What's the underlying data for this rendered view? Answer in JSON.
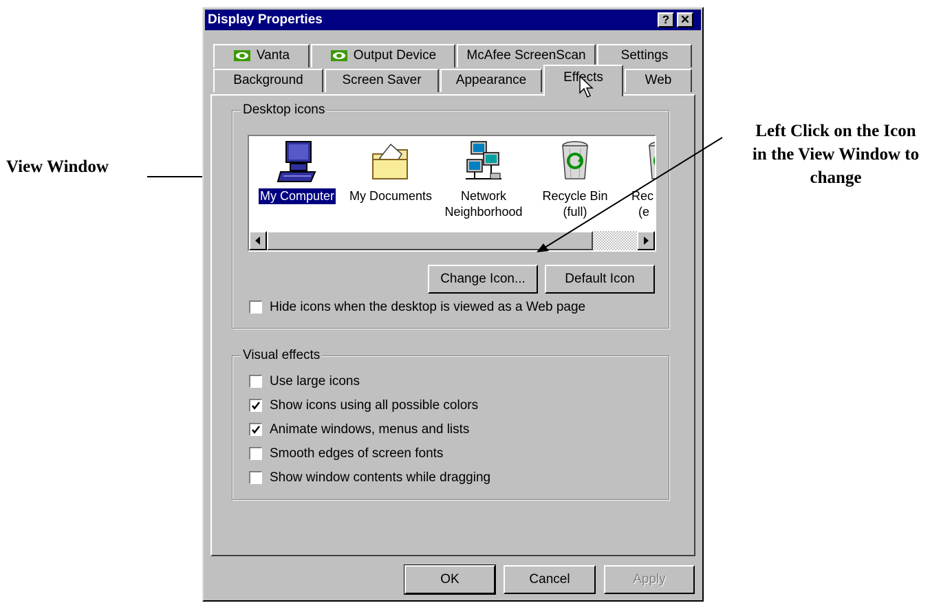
{
  "annotations": {
    "view_window_label": "View Window",
    "instruction_line1": "Left Click on the Icon",
    "instruction_line2": "in the View Window to",
    "instruction_line3": "change"
  },
  "window": {
    "title": "Display Properties",
    "help_button": "?",
    "close_button": "✕"
  },
  "tabs_back": [
    {
      "label": "Vanta",
      "icon": "nvidia-icon"
    },
    {
      "label": "Output Device",
      "icon": "nvidia-icon"
    },
    {
      "label": "McAfee ScreenScan"
    },
    {
      "label": "Settings"
    }
  ],
  "tabs_front": [
    {
      "label": "Background"
    },
    {
      "label": "Screen Saver"
    },
    {
      "label": "Appearance"
    },
    {
      "label": "Effects",
      "active": true
    },
    {
      "label": "Web"
    }
  ],
  "desktop_icons": {
    "legend": "Desktop icons",
    "items": [
      {
        "label": "My Computer",
        "icon": "my-computer-icon",
        "selected": true
      },
      {
        "label": "My Documents",
        "icon": "folder-icon"
      },
      {
        "label_line1": "Network",
        "label_line2": "Neighborhood",
        "icon": "network-neighborhood-icon"
      },
      {
        "label_line1": "Recycle Bin",
        "label_line2": "(full)",
        "icon": "recycle-bin-full-icon"
      },
      {
        "label_line1": "Rec",
        "label_line2": "(e",
        "icon": "recycle-bin-empty-icon"
      }
    ],
    "change_icon_button": "Change Icon...",
    "default_icon_button": "Default Icon",
    "hide_icons_label": "Hide icons when the desktop is viewed as a Web page",
    "hide_icons_checked": false
  },
  "visual_effects": {
    "legend": "Visual effects",
    "options": [
      {
        "label": "Use large icons",
        "checked": false
      },
      {
        "label": "Show icons using all possible colors",
        "checked": true
      },
      {
        "label": "Animate windows, menus and lists",
        "checked": true
      },
      {
        "label": "Smooth edges of screen fonts",
        "checked": false
      },
      {
        "label": "Show window contents while dragging",
        "checked": false
      }
    ]
  },
  "buttons": {
    "ok": "OK",
    "cancel": "Cancel",
    "apply": "Apply"
  },
  "colors": {
    "titlebar": "#000080",
    "face": "#c0c0c0",
    "selection": "#000080"
  }
}
